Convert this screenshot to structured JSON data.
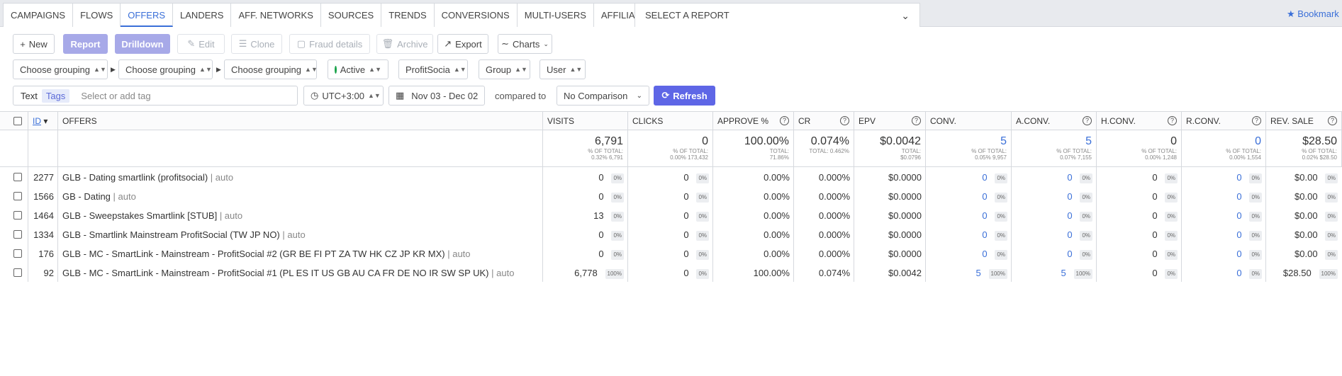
{
  "nav": {
    "tabs": [
      "CAMPAIGNS",
      "FLOWS",
      "OFFERS",
      "LANDERS",
      "AFF. NETWORKS",
      "SOURCES",
      "TRENDS",
      "CONVERSIONS",
      "MULTI-USERS",
      "AFFILIATE PANEL"
    ],
    "active_tab": "OFFERS",
    "report_select": "SELECT A REPORT",
    "bookmark": "Bookmark"
  },
  "toolbar": {
    "new": "New",
    "report": "Report",
    "drilldown": "Drilldown",
    "edit": "Edit",
    "clone": "Clone",
    "fraud": "Fraud details",
    "archive": "Archive",
    "export": "Export",
    "charts": "Charts"
  },
  "filters": {
    "grouping1": "Choose grouping",
    "grouping2": "Choose grouping",
    "grouping3": "Choose grouping",
    "status": "Active",
    "network": "ProfitSocia",
    "group": "Group",
    "user": "User"
  },
  "tagrow": {
    "text_label": "Text",
    "tags_label": "Tags",
    "tag_placeholder": "Select or add tag",
    "timezone": "UTC+3:00",
    "date_range": "Nov 03 - Dec 02",
    "compared_to": "compared to",
    "comparison": "No Comparison",
    "refresh": "Refresh"
  },
  "table": {
    "headers": {
      "id": "ID",
      "offers": "OFFERS",
      "visits": "VISITS",
      "clicks": "CLICKS",
      "approve": "APPROVE %",
      "cr": "CR",
      "epv": "EPV",
      "conv": "CONV.",
      "aconv": "A.CONV.",
      "hconv": "H.CONV.",
      "rconv": "R.CONV.",
      "revsale": "REV. SALE"
    },
    "totals": {
      "visits": "6,791",
      "visits_sub1": "% OF TOTAL:",
      "visits_sub2": "0.32% 6,791",
      "clicks": "0",
      "clicks_sub1": "% OF TOTAL:",
      "clicks_sub2": "0.00% 173,432",
      "approve": "100.00%",
      "approve_sub1": "TOTAL:",
      "approve_sub2": "71.86%",
      "cr": "0.074%",
      "cr_sub1": "TOTAL: 0.462%",
      "epv": "$0.0042",
      "epv_sub1": "TOTAL:",
      "epv_sub2": "$0.0796",
      "conv": "5",
      "conv_sub1": "% OF TOTAL:",
      "conv_sub2": "0.05% 9,957",
      "aconv": "5",
      "aconv_sub1": "% OF TOTAL:",
      "aconv_sub2": "0.07% 7,155",
      "hconv": "0",
      "hconv_sub1": "% OF TOTAL:",
      "hconv_sub2": "0.00% 1,248",
      "rconv": "0",
      "rconv_sub1": "% OF TOTAL:",
      "rconv_sub2": "0.00% 1,554",
      "revsale": "$28.50",
      "revsale_sub1": "% OF TOTAL:",
      "revsale_sub2": "0.02% $28.50"
    },
    "rows": [
      {
        "id": "2277",
        "name": "GLB - Dating smartlink (profitsocial)",
        "suffix": "| auto",
        "visits": "0",
        "visits_pct": "0%",
        "clicks": "0",
        "clicks_pct": "0%",
        "approve": "0.00%",
        "cr": "0.000%",
        "epv": "$0.0000",
        "conv": "0",
        "conv_pct": "0%",
        "aconv": "0",
        "aconv_pct": "0%",
        "hconv": "0",
        "hconv_pct": "0%",
        "rconv": "0",
        "rconv_pct": "0%",
        "revsale": "$0.00",
        "revsale_pct": "0%"
      },
      {
        "id": "1566",
        "name": "GB - Dating",
        "suffix": "| auto",
        "visits": "0",
        "visits_pct": "0%",
        "clicks": "0",
        "clicks_pct": "0%",
        "approve": "0.00%",
        "cr": "0.000%",
        "epv": "$0.0000",
        "conv": "0",
        "conv_pct": "0%",
        "aconv": "0",
        "aconv_pct": "0%",
        "hconv": "0",
        "hconv_pct": "0%",
        "rconv": "0",
        "rconv_pct": "0%",
        "revsale": "$0.00",
        "revsale_pct": "0%"
      },
      {
        "id": "1464",
        "name": "GLB - Sweepstakes Smartlink [STUB]",
        "suffix": "| auto",
        "visits": "13",
        "visits_pct": "0%",
        "clicks": "0",
        "clicks_pct": "0%",
        "approve": "0.00%",
        "cr": "0.000%",
        "epv": "$0.0000",
        "conv": "0",
        "conv_pct": "0%",
        "aconv": "0",
        "aconv_pct": "0%",
        "hconv": "0",
        "hconv_pct": "0%",
        "rconv": "0",
        "rconv_pct": "0%",
        "revsale": "$0.00",
        "revsale_pct": "0%"
      },
      {
        "id": "1334",
        "name": "GLB - Smartlink Mainstream ProfitSocial (TW JP NO)",
        "suffix": "| auto",
        "visits": "0",
        "visits_pct": "0%",
        "clicks": "0",
        "clicks_pct": "0%",
        "approve": "0.00%",
        "cr": "0.000%",
        "epv": "$0.0000",
        "conv": "0",
        "conv_pct": "0%",
        "aconv": "0",
        "aconv_pct": "0%",
        "hconv": "0",
        "hconv_pct": "0%",
        "rconv": "0",
        "rconv_pct": "0%",
        "revsale": "$0.00",
        "revsale_pct": "0%"
      },
      {
        "id": "176",
        "name": "GLB - MC - SmartLink - Mainstream - ProfitSocial #2 (GR BE FI PT ZA TW HK CZ JP KR MX)",
        "suffix": "| auto",
        "visits": "0",
        "visits_pct": "0%",
        "clicks": "0",
        "clicks_pct": "0%",
        "approve": "0.00%",
        "cr": "0.000%",
        "epv": "$0.0000",
        "conv": "0",
        "conv_pct": "0%",
        "aconv": "0",
        "aconv_pct": "0%",
        "hconv": "0",
        "hconv_pct": "0%",
        "rconv": "0",
        "rconv_pct": "0%",
        "revsale": "$0.00",
        "revsale_pct": "0%"
      },
      {
        "id": "92",
        "name": "GLB - MC - SmartLink - Mainstream - ProfitSocial #1 (PL ES IT US GB AU CA FR DE NO IR SW SP UK)",
        "suffix": "| auto",
        "visits": "6,778",
        "visits_pct": "100%",
        "clicks": "0",
        "clicks_pct": "0%",
        "approve": "100.00%",
        "cr": "0.074%",
        "epv": "$0.0042",
        "conv": "5",
        "conv_pct": "100%",
        "aconv": "5",
        "aconv_pct": "100%",
        "hconv": "0",
        "hconv_pct": "0%",
        "rconv": "0",
        "rconv_pct": "0%",
        "revsale": "$28.50",
        "revsale_pct": "100%"
      }
    ]
  }
}
